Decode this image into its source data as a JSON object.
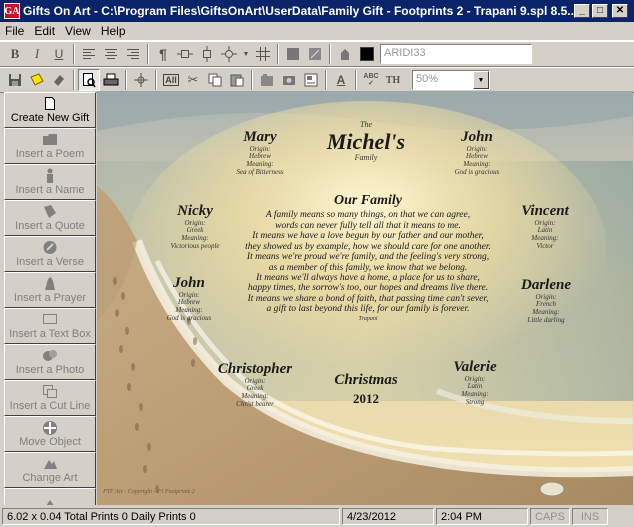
{
  "window": {
    "title": "Gifts On Art - C:\\Program Files\\GiftsOnArt\\UserData\\Family Gift - Footprints 2 - Trapani 9.spl 8.5...",
    "icon_text": "GA",
    "minimize": "_",
    "maximize": "□",
    "close": "✕"
  },
  "menu": [
    "File",
    "Edit",
    "View",
    "Help"
  ],
  "toolbar": {
    "bold": "B",
    "italic": "I",
    "underline": "U",
    "paragraph": "¶",
    "font_value": "ARIDI33",
    "zoom_value": "50%",
    "caps_a": "A",
    "abc": "ABC",
    "th": "TH"
  },
  "sidebar": [
    {
      "label": "Create New Gift",
      "icon": "new-page-icon"
    },
    {
      "label": "Insert a Poem",
      "icon": "poem-icon"
    },
    {
      "label": "Insert a Name",
      "icon": "name-icon"
    },
    {
      "label": "Insert a Quote",
      "icon": "quote-icon"
    },
    {
      "label": "Insert a Verse",
      "icon": "verse-icon"
    },
    {
      "label": "Insert a Prayer",
      "icon": "prayer-icon"
    },
    {
      "label": "Insert a Text Box",
      "icon": "text-box-icon"
    },
    {
      "label": "Insert a Photo",
      "icon": "photo-icon"
    },
    {
      "label": "Insert a Cut Line",
      "icon": "cut-line-icon"
    },
    {
      "label": "Move Object",
      "icon": "move-icon"
    },
    {
      "label": "Change Art",
      "icon": "art-icon"
    }
  ],
  "canvas": {
    "family_the": "The",
    "family_name": "Michel's",
    "family_sub": "Family",
    "poem_title": "Our Family",
    "poem_lines": [
      "A family means so many things, on that we can agree,",
      "words can never fully tell all that it means to me.",
      "It means we have a love begun by our father and our mother,",
      "they showed us by example, how we should care for one another.",
      "It means we're proud we're family, and the feeling's very strong,",
      "as a member of this family, we know that we belong.",
      "It means we'll always have a home, a place for us to share,",
      "happy times, the sorrow's too, our hopes and dreams live there.",
      "It means we share a bond of faith, that passing time can't sever,",
      "a gift to last beyond this life, for our family is forever."
    ],
    "poem_author": "Trapani",
    "names": {
      "mary": {
        "name": "Mary",
        "l1": "Origin:",
        "l2": "Hebrew",
        "l3": "Meaning:",
        "l4": "Sea of Bitterness"
      },
      "john1": {
        "name": "John",
        "l1": "Origin:",
        "l2": "Hebrew",
        "l3": "Meaning:",
        "l4": "God is gracious"
      },
      "nicky": {
        "name": "Nicky",
        "l1": "Origin:",
        "l2": "Greek",
        "l3": "Meaning:",
        "l4": "Victorious people"
      },
      "vincent": {
        "name": "Vincent",
        "l1": "Origin:",
        "l2": "Latin",
        "l3": "Meaning:",
        "l4": "Victor"
      },
      "john2": {
        "name": "John",
        "l1": "Origin:",
        "l2": "Hebrew",
        "l3": "Meaning:",
        "l4": "God is gracious"
      },
      "darlene": {
        "name": "Darlene",
        "l1": "Origin:",
        "l2": "French",
        "l3": "Meaning:",
        "l4": "Little darling"
      },
      "christopher": {
        "name": "Christopher",
        "l1": "Origin:",
        "l2": "Greek",
        "l3": "Meaning:",
        "l4": "Christ bearer"
      },
      "valerie": {
        "name": "Valerie",
        "l1": "Origin:",
        "l2": "Latin",
        "l3": "Meaning:",
        "l4": "Strong"
      }
    },
    "christmas": "Christmas",
    "year": "2012",
    "copyright": "PTF Art - Copyright - PJ Footprints 2"
  },
  "status": {
    "info": "6.02 x 0.04 Total Prints 0 Daily Prints 0",
    "date": "4/23/2012",
    "time": "2:04 PM",
    "caps": "CAPS",
    "ins": "INS"
  }
}
